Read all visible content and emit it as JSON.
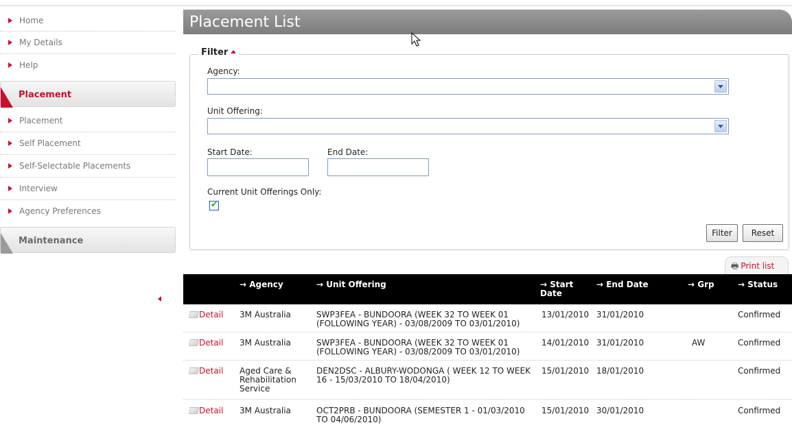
{
  "sidebar": {
    "top_items": [
      {
        "label": "Home"
      },
      {
        "label": "My Details"
      },
      {
        "label": "Help"
      }
    ],
    "placement_section": "Placement",
    "placement_items": [
      {
        "label": "Placement"
      },
      {
        "label": "Self Placement"
      },
      {
        "label": "Self-Selectable Placements"
      },
      {
        "label": "Interview"
      },
      {
        "label": "Agency Preferences"
      }
    ],
    "maintenance_section": "Maintenance"
  },
  "page": {
    "title": "Placement List"
  },
  "filter": {
    "legend": "Filter",
    "agency_label": "Agency:",
    "agency_value": "",
    "unit_offering_label": "Unit Offering:",
    "unit_offering_value": "",
    "start_date_label": "Start Date:",
    "start_date_value": "",
    "end_date_label": "End Date:",
    "end_date_value": "",
    "current_only_label": "Current Unit Offerings Only:",
    "current_only_checked": true,
    "filter_button": "Filter",
    "reset_button": "Reset"
  },
  "print_list": "Print list",
  "table": {
    "headers": {
      "agency": "Agency",
      "unit_offering": "Unit Offering",
      "start_date": "Start Date",
      "end_date": "End Date",
      "grp": "Grp",
      "status": "Status"
    },
    "rows": [
      {
        "action": "Detail",
        "agency": "3M Australia",
        "unit_offering": "SWP3FEA - BUNDOORA (WEEK 32 TO WEEK 01 (FOLLOWING YEAR) - 03/08/2009 TO 03/01/2010)",
        "start_date": "13/01/2010",
        "end_date": "31/01/2010",
        "grp": "",
        "status": "Confirmed"
      },
      {
        "action": "Detail",
        "agency": "3M Australia",
        "unit_offering": "SWP3FEA - BUNDOORA (WEEK 32 TO WEEK 01 (FOLLOWING YEAR) - 03/08/2009 TO 03/01/2010)",
        "start_date": "14/01/2010",
        "end_date": "31/01/2010",
        "grp": "AW",
        "status": "Confirmed"
      },
      {
        "action": "Detail",
        "agency": "Aged Care & Rehabilitation Service",
        "unit_offering": "DEN2DSC - ALBURY-WODONGA ( WEEK 12 TO WEEK 16 - 15/03/2010 TO 18/04/2010)",
        "start_date": "15/01/2010",
        "end_date": "18/01/2010",
        "grp": "",
        "status": "Confirmed"
      },
      {
        "action": "Detail",
        "agency": "3M Australia",
        "unit_offering": "OCT2PRB - BUNDOORA (SEMESTER 1 - 01/03/2010 TO 04/06/2010)",
        "start_date": "15/01/2010",
        "end_date": "30/01/2010",
        "grp": "",
        "status": "Confirmed"
      }
    ]
  },
  "colors": {
    "accent": "#c8102e",
    "title_bar": "#8a8a8a",
    "table_header": "#000000"
  }
}
